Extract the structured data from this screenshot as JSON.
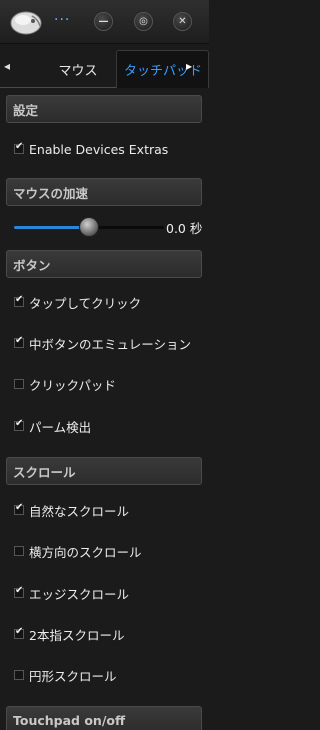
{
  "titlebar": {
    "title_text": "···"
  },
  "tabs": {
    "scroll_left": "◂",
    "mouse_label": "マウス",
    "touchpad_label": "タッチパッド",
    "scroll_right": "▸"
  },
  "settings": {
    "header": "設定",
    "enable_devices_extras": {
      "label": "Enable Devices Extras",
      "checked": true
    }
  },
  "mouse_accel": {
    "header": "マウスの加速",
    "value_text": "0.0 秒",
    "slider_fraction": 0.5
  },
  "buttons": {
    "header": "ボタン",
    "items": [
      {
        "label": "タップしてクリック",
        "checked": true
      },
      {
        "label": "中ボタンのエミュレーション",
        "checked": true
      },
      {
        "label": "クリックパッド",
        "checked": false
      },
      {
        "label": "パーム検出",
        "checked": true
      }
    ]
  },
  "scroll": {
    "header": "スクロール",
    "items": [
      {
        "label": "自然なスクロール",
        "checked": true
      },
      {
        "label": "横方向のスクロール",
        "checked": false
      },
      {
        "label": "エッジスクロール",
        "checked": true
      },
      {
        "label": "2本指スクロール",
        "checked": true
      },
      {
        "label": "円形スクロール",
        "checked": false
      }
    ]
  },
  "touchpad_onoff": {
    "header": "Touchpad on/off"
  },
  "colors": {
    "accent": "#3d9bff",
    "slider_fill": "#2c86d8",
    "background": "#1b1b1b"
  }
}
